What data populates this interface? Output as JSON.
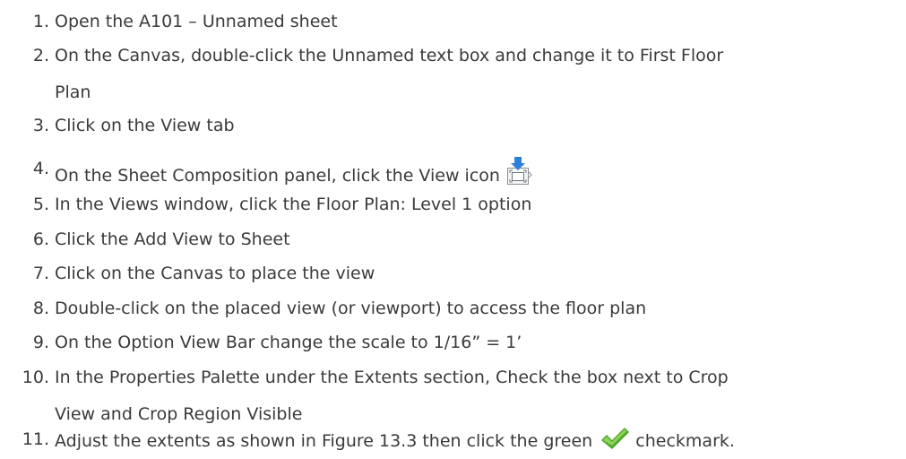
{
  "steps": [
    {
      "num": "1.",
      "lines": [
        "Open the A101 – Unnamed sheet"
      ]
    },
    {
      "num": "2.",
      "lines": [
        "On the Canvas, double-click the Unnamed text box and change it to First Floor",
        "Plan"
      ]
    },
    {
      "num": "3.",
      "lines": [
        "Click on the View tab"
      ]
    },
    {
      "num": "4.",
      "lines": [
        "On the Sheet Composition panel, click the View icon"
      ],
      "icon": "view-place-icon"
    },
    {
      "num": "5.",
      "lines": [
        "In the Views window, click the Floor Plan: Level 1 option"
      ]
    },
    {
      "num": "6.",
      "lines": [
        "Click the Add View to Sheet"
      ]
    },
    {
      "num": "7.",
      "lines": [
        "Click on the Canvas to place the view"
      ]
    },
    {
      "num": "8.",
      "lines": [
        "Double-click on the placed view (or viewport) to access the floor plan"
      ]
    },
    {
      "num": "9.",
      "lines": [
        "On the Option View Bar change the scale to 1/16” = 1’"
      ]
    },
    {
      "num": "10.",
      "lines": [
        "In the Properties Palette under the Extents section, Check the box next to Crop",
        "View and Crop Region Visible"
      ]
    },
    {
      "num": "11.",
      "lines": [
        "Adjust the extents as shown in Figure 13.3 then click the green",
        "checkmark."
      ],
      "icon": "green-checkmark-icon"
    }
  ],
  "colors": {
    "text": "#3a3a3a",
    "check_green": "#5cb82e",
    "icon_blue": "#2f7fd8"
  }
}
